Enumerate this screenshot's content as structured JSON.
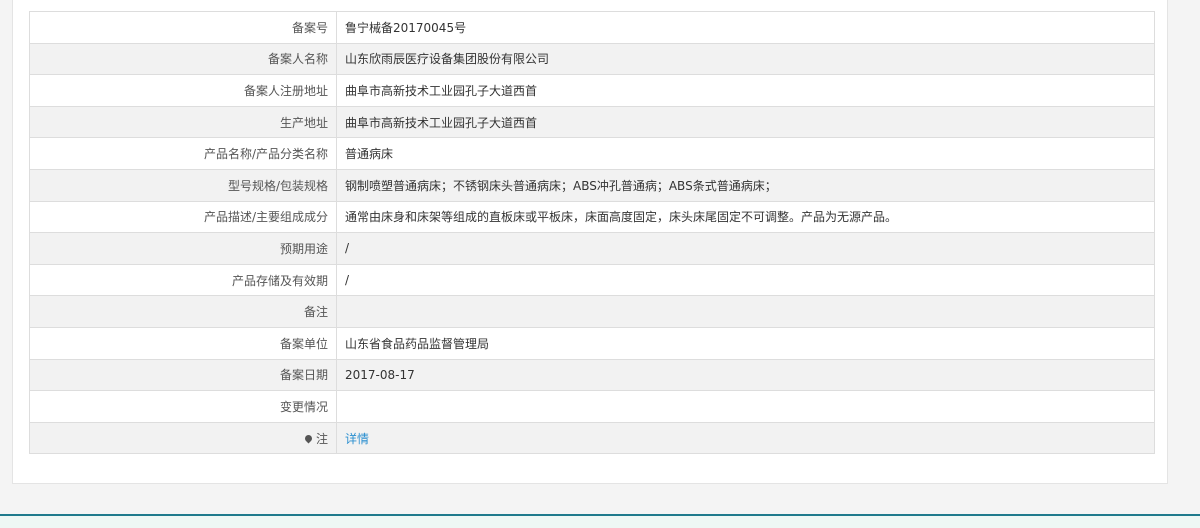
{
  "record": {
    "rows": [
      {
        "label": "备案号",
        "value": "鲁宁械备20170045号"
      },
      {
        "label": "备案人名称",
        "value": "山东欣雨辰医疗设备集团股份有限公司"
      },
      {
        "label": "备案人注册地址",
        "value": "曲阜市高新技术工业园孔子大道西首"
      },
      {
        "label": "生产地址",
        "value": "曲阜市高新技术工业园孔子大道西首"
      },
      {
        "label": "产品名称/产品分类名称",
        "value": "普通病床"
      },
      {
        "label": "型号规格/包装规格",
        "value": "钢制喷塑普通病床；不锈钢床头普通病床；ABS冲孔普通病；ABS条式普通病床；"
      },
      {
        "label": "产品描述/主要组成成分",
        "value": "通常由床身和床架等组成的直板床或平板床，床面高度固定，床头床尾固定不可调整。产品为无源产品。"
      },
      {
        "label": "预期用途",
        "value": "/"
      },
      {
        "label": "产品存储及有效期",
        "value": "/"
      },
      {
        "label": "备注",
        "value": ""
      },
      {
        "label": "备案单位",
        "value": "山东省食品药品监督管理局"
      },
      {
        "label": "备案日期",
        "value": "2017-08-17"
      },
      {
        "label": "变更情况",
        "value": ""
      },
      {
        "label": "注",
        "value": "详情"
      }
    ]
  },
  "icons": {
    "note_icon": "map-pin-icon"
  },
  "colors": {
    "link": "#2a8fd0",
    "border": "#dddddd",
    "alt_row": "#f2f2f2",
    "footer_accent": "#1f7a8c"
  }
}
